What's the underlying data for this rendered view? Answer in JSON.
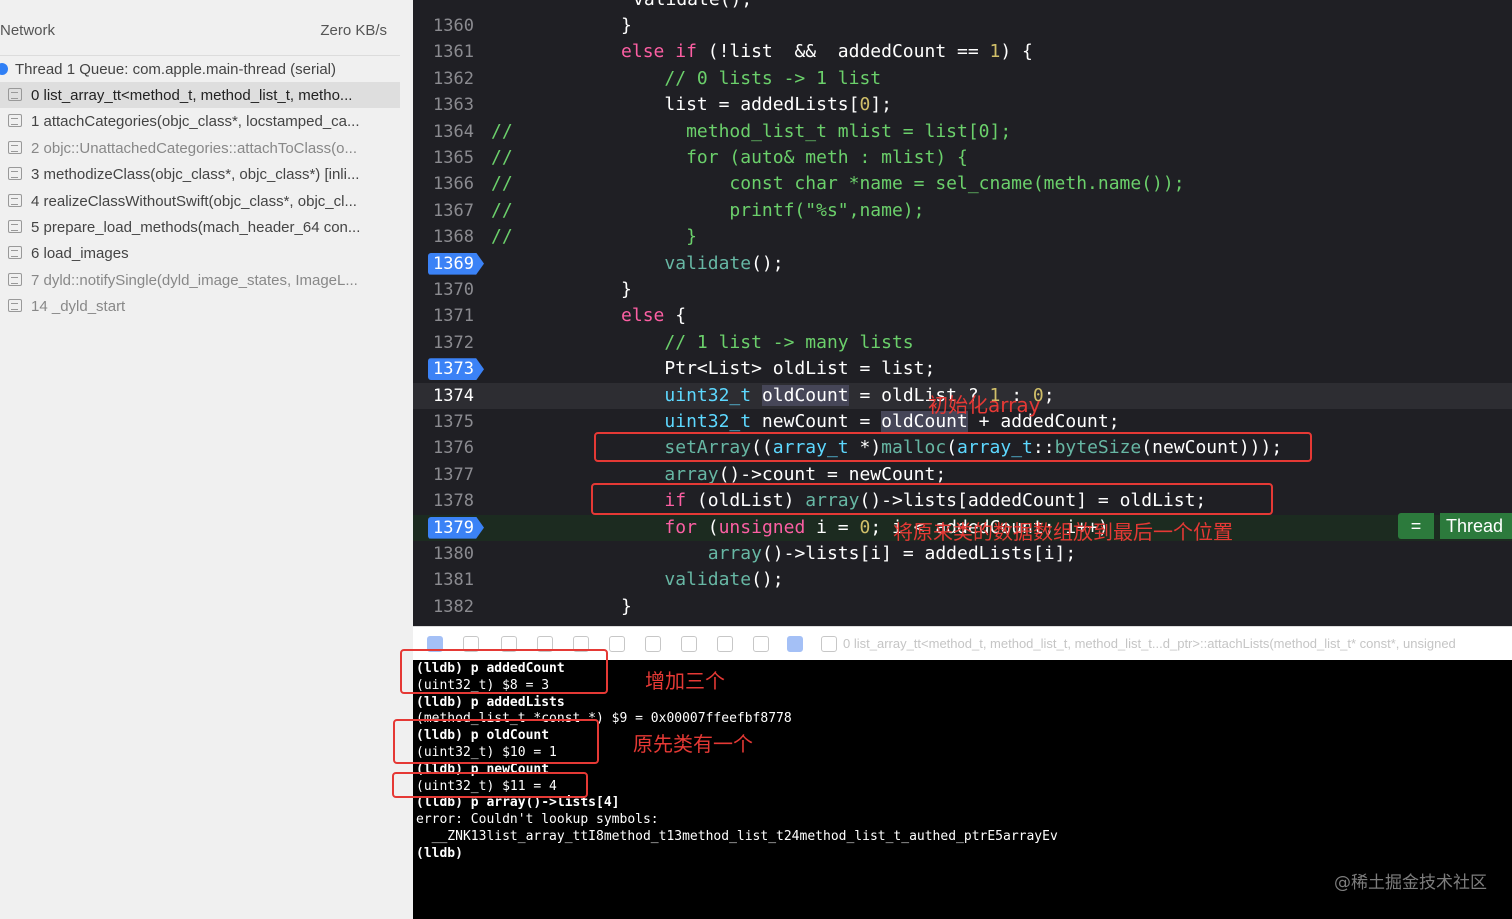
{
  "navigator": {
    "header_name": "Network",
    "header_value": "Zero KB/s",
    "thread_label": "Thread 1 Queue: com.apple.main-thread (serial)",
    "frames": [
      "0 list_array_tt<method_t, method_list_t, metho...",
      "1 attachCategories(objc_class*, locstamped_ca...",
      "2 objc::UnattachedCategories::attachToClass(o...",
      "3 methodizeClass(objc_class*, objc_class*) [inli...",
      "4 realizeClassWithoutSwift(objc_class*, objc_cl...",
      "5 prepare_load_methods(mach_header_64 con...",
      "6 load_images",
      "7 dyld::notifySingle(dyld_image_states, ImageL...",
      "14 _dyld_start"
    ]
  },
  "editor": {
    "partial_top_code": "validate();",
    "line_numbers": [
      "1360",
      "1361",
      "1362",
      "1363",
      "1364",
      "1365",
      "1366",
      "1367",
      "1368",
      "1369",
      "1370",
      "1371",
      "1372",
      "1373",
      "1374",
      "1375",
      "1376",
      "1377",
      "1378",
      "1379",
      "1380",
      "1381",
      "1382"
    ],
    "current_line": "1374",
    "breakpoints": [
      "1369",
      "1373",
      "1379"
    ],
    "thread_badge_icon": "=",
    "thread_badge_label": "Thread"
  },
  "annotations": {
    "init_array": "初始化array",
    "move_old_to_last": "将原来类的数据数组放到最后一个位置",
    "added_three": "增加三个",
    "originally_one": "原先类有一个"
  },
  "debug_bar": {
    "breadcrumb": "0 list_array_tt<method_t, method_list_t, method_list_t...d_ptr>::attachLists(method_list_t* const*, unsigned"
  },
  "console": {
    "lines": [
      "(lldb) p addedCount",
      "(uint32_t) $8 = 3",
      "(lldb) p addedLists",
      "(method_list_t *const *) $9 = 0x00007ffeefbf8778",
      "(lldb) p oldCount",
      "(uint32_t) $10 = 1",
      "(lldb) p newCount",
      "(uint32_t) $11 = 4",
      "(lldb) p array()->lists[4]",
      "error: Couldn't lookup symbols:",
      "  __ZNK13list_array_ttI8method_t13method_list_t24method_list_t_authed_ptrE5arrayEv",
      "(lldb)"
    ],
    "watermark": "@稀土掘金技术社区"
  },
  "colors": {
    "editor_bg": "#1f1f24",
    "keyword": "#fc5fa3",
    "comment": "#6bd06b",
    "type": "#5dd8ff",
    "number": "#d0bf69",
    "breakpoint": "#3b82f6",
    "annotation": "#e53935"
  }
}
